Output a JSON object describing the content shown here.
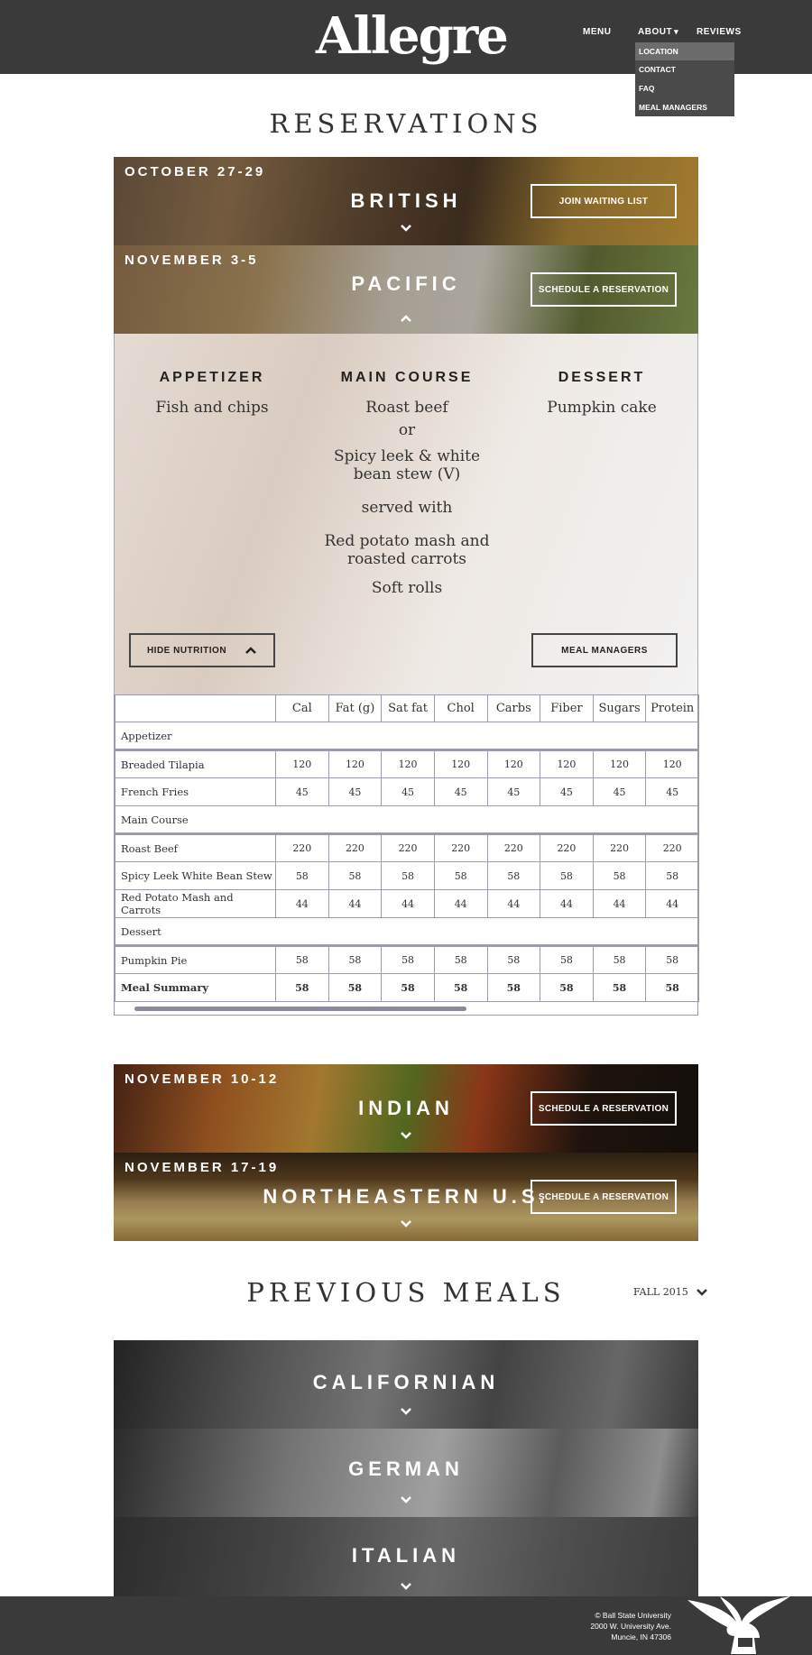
{
  "header": {
    "logo": "Allegre",
    "nav": {
      "menu": "MENU",
      "about": "ABOUT",
      "reviews": "REVIEWS"
    },
    "about_dropdown": [
      "LOCATION",
      "CONTACT",
      "FAQ",
      "MEAL MANAGERS"
    ]
  },
  "reservations": {
    "title": "RESERVATIONS",
    "banners": [
      {
        "date": "OCTOBER 27-29",
        "name": "BRITISH",
        "button": "JOIN WAITING LIST",
        "expanded": false
      },
      {
        "date": "NOVEMBER 3-5",
        "name": "PACIFIC",
        "button": "SCHEDULE A RESERVATION",
        "expanded": true
      },
      {
        "date": "NOVEMBER 10-12",
        "name": "INDIAN",
        "button": "SCHEDULE A RESERVATION",
        "expanded": false
      },
      {
        "date": "NOVEMBER 17-19",
        "name": "NORTHEASTERN U.S.",
        "button": "SCHEDULE A RESERVATION",
        "expanded": false
      }
    ]
  },
  "menu": {
    "appetizer_head": "APPETIZER",
    "main_head": "MAIN COURSE",
    "dessert_head": "DESSERT",
    "appetizer": "Fish and chips",
    "main_1": "Roast beef",
    "main_or": "or",
    "main_2": "Spicy leek & white bean stew (V)",
    "main_served": "served with",
    "main_3": "Red potato mash and roasted carrots",
    "main_4": "Soft rolls",
    "dessert": "Pumpkin cake",
    "hide_nutrition": "HIDE NUTRITION",
    "meal_managers": "MEAL MANAGERS"
  },
  "nutrition": {
    "columns": [
      "Cal",
      "Fat (g)",
      "Sat fat",
      "Chol",
      "Carbs",
      "Fiber",
      "Sugars",
      "Protein"
    ],
    "groups": [
      {
        "name": "Appetizer",
        "rows": [
          {
            "item": "Breaded Tilapia",
            "values": [
              "120",
              "120",
              "120",
              "120",
              "120",
              "120",
              "120",
              "120"
            ]
          },
          {
            "item": "French Fries",
            "values": [
              "45",
              "45",
              "45",
              "45",
              "45",
              "45",
              "45",
              "45"
            ]
          }
        ]
      },
      {
        "name": "Main Course",
        "rows": [
          {
            "item": "Roast Beef",
            "values": [
              "220",
              "220",
              "220",
              "220",
              "220",
              "220",
              "220",
              "220"
            ]
          },
          {
            "item": "Spicy Leek White Bean Stew",
            "values": [
              "58",
              "58",
              "58",
              "58",
              "58",
              "58",
              "58",
              "58"
            ]
          },
          {
            "item": "Red Potato Mash and Carrots",
            "values": [
              "44",
              "44",
              "44",
              "44",
              "44",
              "44",
              "44",
              "44"
            ]
          }
        ]
      },
      {
        "name": "Dessert",
        "rows": [
          {
            "item": "Pumpkin Pie",
            "values": [
              "58",
              "58",
              "58",
              "58",
              "58",
              "58",
              "58",
              "58"
            ]
          }
        ]
      }
    ],
    "summary": {
      "item": "Meal Summary",
      "values": [
        "58",
        "58",
        "58",
        "58",
        "58",
        "58",
        "58",
        "58"
      ]
    }
  },
  "previous": {
    "title": "PREVIOUS MEALS",
    "filter": "FALL 2015",
    "meals": [
      "CALIFORNIAN",
      "GERMAN",
      "ITALIAN"
    ]
  },
  "footer": {
    "line1": "© Ball State University",
    "line2": "2000 W. University Ave.",
    "line3": "Muncie, IN 47306"
  }
}
